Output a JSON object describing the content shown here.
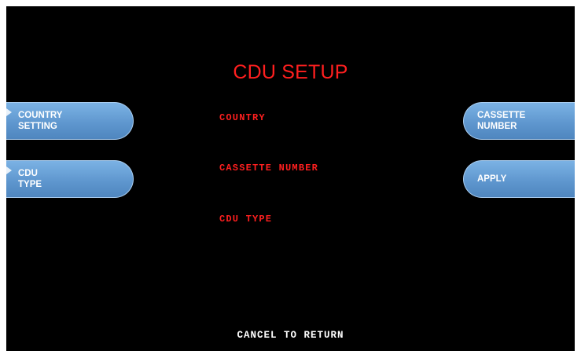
{
  "screen": {
    "title": "CDU SETUP",
    "fields": [
      "COUNTRY",
      "CASSETTE NUMBER",
      "CDU TYPE"
    ],
    "footer": "CANCEL TO RETURN",
    "colors": {
      "background": "#000000",
      "title_text": "#ff1f1f",
      "field_text": "#ff1f1f",
      "button_fill": "#5d95cd",
      "button_text": "#ffffff",
      "footer_text": "#ffffff"
    }
  },
  "left_keys": [
    {
      "label": "COUNTRY\nSETTING"
    },
    {
      "label": "CDU\nTYPE"
    }
  ],
  "right_keys": [
    {
      "label": "CASSETTE\nNUMBER"
    },
    {
      "label": "APPLY"
    }
  ]
}
